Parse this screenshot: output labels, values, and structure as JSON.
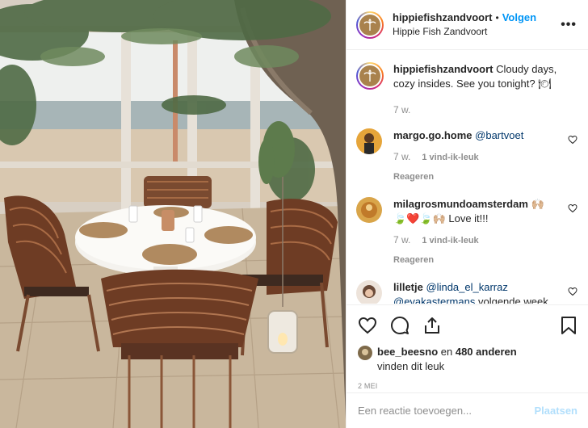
{
  "header": {
    "username": "hippiefishzandvoort",
    "separator": "•",
    "follow_label": "Volgen",
    "subtitle": "Hippie Fish Zandvoort",
    "more_icon": "more-options-icon"
  },
  "caption": {
    "username": "hippiefishzandvoort",
    "text": " Cloudy days, cozy insides. See you tonight? 🍽",
    "time": "7 w."
  },
  "comments": [
    {
      "username": "margo.go.home",
      "mention": "@bartvoet",
      "text": "",
      "time": "7 w.",
      "likes": "1 vind-ik-leuk",
      "reply": "Reageren",
      "avatar_color": "#e0a030"
    },
    {
      "username": "milagrosmundoamsterdam",
      "mention": "",
      "text": " 🙌🏼 🍃❤️🍃🙌🏼 Love it!!!",
      "time": "7 w.",
      "likes": "1 vind-ik-leuk",
      "reply": "Reageren",
      "avatar_color": "#d8a040"
    },
    {
      "username": "lilletje",
      "mention": "@linda_el_karraz @evakastermans",
      "text": " volgende week",
      "avatar_color": "#6a4a38"
    }
  ],
  "actions": {
    "like_icon": "heart-icon",
    "comment_icon": "comment-icon",
    "share_icon": "share-icon",
    "save_icon": "bookmark-icon"
  },
  "likes": {
    "first_liker": "bee_beesno",
    "connector": " en ",
    "others": "480 anderen",
    "suffix": "vinden dit leuk"
  },
  "date": "2 MEI",
  "add_comment": {
    "placeholder": "Een reactie toevoegen...",
    "post_label": "Plaatsen"
  },
  "colors": {
    "link_blue": "#0095f6",
    "mention_blue": "#00376b",
    "muted": "#8e8e8e",
    "post_disabled": "#b2dffc"
  }
}
